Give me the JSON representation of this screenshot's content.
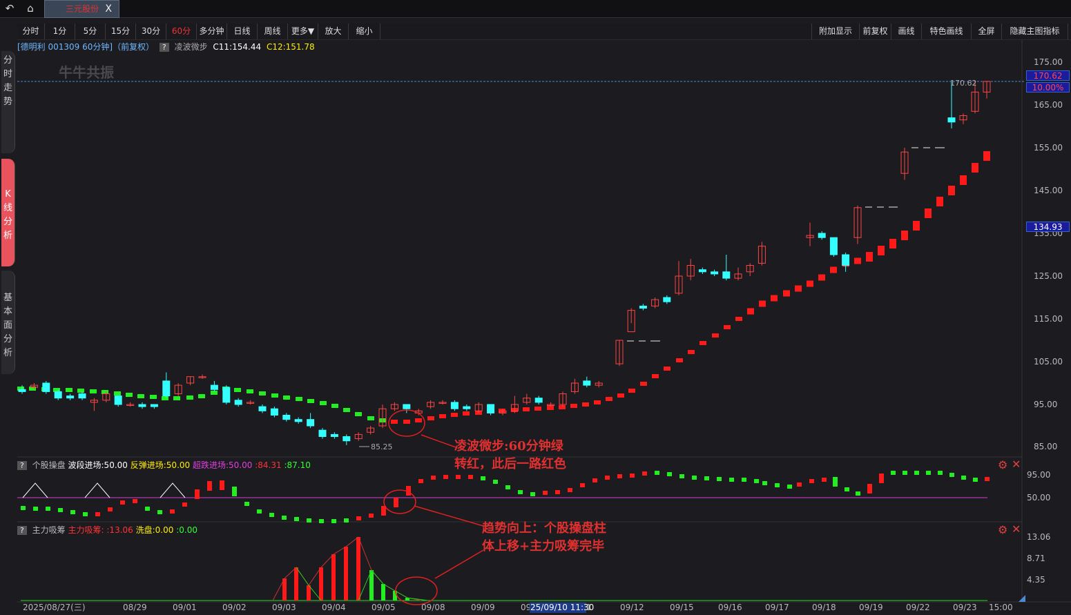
{
  "topbar": {
    "back_icon": "↶",
    "home_icon": "⌂",
    "tab_title": "三元股份",
    "tab_close": "X"
  },
  "sidebar": [
    "分时走势",
    "K线分析",
    "基本面分析"
  ],
  "toolbar": {
    "left": [
      "分时",
      "1分",
      "5分",
      "15分",
      "30分",
      "60分",
      "多分钟",
      "日线",
      "周线",
      "更多▼",
      "放大",
      "缩小"
    ],
    "right": [
      "附加显示",
      "前复权",
      "画线",
      "特色画线",
      "全屏",
      "隐藏主图指标"
    ],
    "selected": "60分"
  },
  "info": {
    "stock": "[德明利 001309 60分钟]（前复权）",
    "indicator": "凌波微步",
    "c11": "C11:154.44",
    "c12": "C12:151.78",
    "q": "?"
  },
  "watermark": "牛牛共振",
  "price_axis": [
    "175.00",
    "165.00",
    "155.00",
    "145.00",
    "135.00",
    "125.00",
    "115.00",
    "105.00",
    "95.00",
    "85.00"
  ],
  "price_boxes": {
    "last": "170.62",
    "pct": "10.00%",
    "line": "134.93"
  },
  "extremes": {
    "high": "170.62",
    "low": "85.25"
  },
  "sub1": {
    "name": "个股操盘",
    "l1": "波段进场:50.00",
    "l2": "反弹进场:50.00",
    "l3": "超跌进场:50.00",
    "l4": ":84.31",
    "l5": ":87.10",
    "axis": [
      "95.00",
      "50.00"
    ]
  },
  "sub2": {
    "name": "主力吸筹",
    "l1": "主力吸筹:",
    "l2": ":13.06",
    "l3": "洗盘:0.00",
    "l4": ":0.00",
    "axis": [
      "13.06",
      "8.71",
      "4.35"
    ]
  },
  "dates": [
    "2025/08/27(三)",
    "08/29",
    "09/01",
    "09/02",
    "09/03",
    "09/04",
    "09/05",
    "09/08",
    "09/09",
    "09",
    "09/12",
    "09/15",
    "09/16",
    "09/17",
    "09/18",
    "09/19",
    "09/22",
    "09/23",
    "15:00"
  ],
  "cursor_date": "25/09/10 11:30",
  "cursor_tail": "1",
  "annotations": {
    "a1": [
      "凌波微步:60分钟绿",
      "转红，此后一路红色"
    ],
    "a2": [
      "趋势向上：个股操盘柱",
      "体上移+主力吸筹完毕"
    ]
  },
  "colors": {
    "up": "#ff4444",
    "down": "#33ffff",
    "red_dot": "#ff1a1a",
    "green_dot": "#22ee22",
    "text_blue": "#6fb7ff"
  },
  "icons": {
    "gear": "gear-icon",
    "close": "close-icon"
  }
}
